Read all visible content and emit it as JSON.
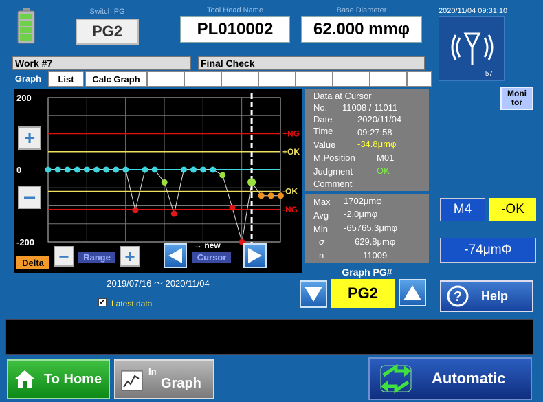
{
  "header": {
    "switch_pg_label": "Switch PG",
    "switch_pg_value": "PG2",
    "tool_head_label": "Tool Head Name",
    "tool_head_value": "PL010002",
    "base_diameter_label": "Base Diameter",
    "base_diameter_value": "62.000 mmφ",
    "datetime": "2020/11/04 09:31:10",
    "signal_count": "57"
  },
  "work_title": "Work #7",
  "step_title": "Final Check",
  "tabs": [
    "Graph",
    "List",
    "Calc Graph",
    "",
    "",
    "",
    "",
    "",
    "",
    "",
    ""
  ],
  "cursor_info": {
    "title": "Data at Cursor",
    "no_label": "No.",
    "no_value": "11008 / 11011",
    "date_label": "Date",
    "date_value": "2020/11/04",
    "time_label": "Time",
    "time_value": "09:27:58",
    "value_label": "Value",
    "value_value": "-34.8μmφ",
    "mpos_label": "M.Position",
    "mpos_value": "M01",
    "judgment_label": "Judgment",
    "judgment_value": "OK",
    "comment_label": "Comment"
  },
  "stats": {
    "max_label": "Max",
    "max_value": "1702μmφ",
    "avg_label": "Avg",
    "avg_value": "-2.0μmφ",
    "min_label": "Min",
    "min_value": "-65765.3μmφ",
    "sigma_label": "σ",
    "sigma_value": "629.8μmφ",
    "n_label": "n",
    "n_value": "11009"
  },
  "graph_controls": {
    "delta_label": "Delta",
    "range_label": "Range",
    "new_label": "→ new",
    "cursor_label": "Cursor",
    "date_range": "2019/07/16 ～ 2020/11/04",
    "latest_data_label": "Latest data",
    "graph_pg_label": "Graph PG#",
    "graph_pg_value": "PG2"
  },
  "right_panel": {
    "monitor_label": "Moni tor",
    "position": "M4",
    "judgment": "-OK",
    "value": "-74μmΦ",
    "help_label": "Help"
  },
  "footer": {
    "home_label": "To Home",
    "graph_in": "In",
    "graph_label": "Graph",
    "auto_label": "Automatic"
  },
  "colors": {
    "background": "#1763a8",
    "ng_line": "#e01010",
    "ok_line": "#f0e060",
    "zero_line": "#40d8e0",
    "point_cyan": "#3fd6e0",
    "point_red": "#e01818",
    "point_green": "#9ae040",
    "point_orange": "#f09020",
    "judgment_ok": "#f8f800"
  },
  "chart_data": {
    "type": "scatter",
    "y_tick_labels": [
      "200",
      "0",
      "-200"
    ],
    "ylim": [
      -200,
      200
    ],
    "limit_labels": [
      "+NG",
      "+OK",
      "-OK",
      "-NG"
    ],
    "limits": {
      "plus_ng": 100,
      "plus_ok": 50,
      "minus_ok": -60,
      "minus_ng": -110
    },
    "series": [
      {
        "values": [
          0,
          0,
          0,
          0,
          0,
          0,
          0,
          0,
          0,
          -112,
          0,
          0,
          -35,
          -122,
          0,
          0,
          0,
          0,
          -15,
          -105,
          -200,
          -34.8,
          -72,
          -72,
          -72
        ]
      }
    ],
    "point_colors": [
      "cyan",
      "cyan",
      "cyan",
      "cyan",
      "cyan",
      "cyan",
      "cyan",
      "cyan",
      "cyan",
      "red",
      "cyan",
      "cyan",
      "green",
      "red",
      "cyan",
      "cyan",
      "cyan",
      "cyan",
      "green",
      "red",
      "red",
      "green",
      "orange",
      "orange",
      "orange"
    ],
    "cursor_index": 21,
    "grid": true
  }
}
